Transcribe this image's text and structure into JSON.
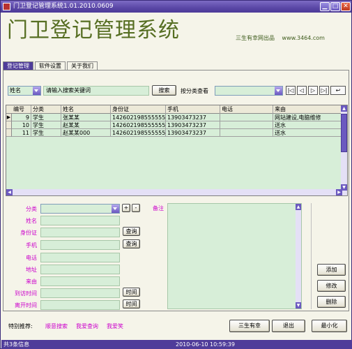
{
  "window": {
    "title": "门卫登记管理系统1.01.2010.0609"
  },
  "banner": {
    "title": "门卫登记管理系统",
    "credit": "三生有幸网出品",
    "url": "www.3464.com"
  },
  "tabs": [
    "登记管理",
    "软件设置",
    "关于我们"
  ],
  "search": {
    "field": "姓名",
    "placeholder_value": "请输入搜索关键词",
    "search_button": "搜索",
    "category_label": "按分类查看",
    "category_value": "",
    "nav": [
      "|◁",
      "◁",
      "▷",
      "▷|",
      "↩"
    ]
  },
  "grid": {
    "columns": [
      "编号",
      "分类",
      "姓名",
      "身份证",
      "手机",
      "电话",
      "来由"
    ],
    "rows": [
      {
        "id": "9",
        "category": "学生",
        "name": "张某某",
        "idcard": "142602198555555",
        "mobile": "13903473237",
        "phone": "",
        "reason": "网站建设,电脑维修"
      },
      {
        "id": "10",
        "category": "学生",
        "name": "赵某某",
        "idcard": "142602198555555",
        "mobile": "13903473237",
        "phone": "",
        "reason": "送水"
      },
      {
        "id": "11",
        "category": "学生",
        "name": "赵某某000",
        "idcard": "142602198555555",
        "mobile": "13903473237",
        "phone": "",
        "reason": "送水"
      }
    ],
    "selected_row": 0
  },
  "form": {
    "labels": [
      "分类",
      "姓名",
      "身份证",
      "手机",
      "电话",
      "地址",
      "来由",
      "到访时间",
      "离开时间"
    ],
    "lookup_button": "查询",
    "time_button": "时间",
    "add_symbol": "+",
    "remove_symbol": "-",
    "memo_label": "备注"
  },
  "actions": {
    "add": "添加",
    "edit": "修改",
    "delete": "删除"
  },
  "footer": {
    "special_label": "特别推荐:",
    "links": [
      "顺意搜索",
      "我爱查询",
      "我爱笑"
    ],
    "buttons": [
      "三生有幸",
      "退出",
      "最小化"
    ]
  },
  "status": {
    "count": "共3条信息",
    "datetime": "2010-06-10 10:59:39"
  },
  "colors": {
    "accent": "#4f3c9a",
    "field": "#d7eed8",
    "title_green": "#566e22",
    "label_magenta": "#cc00cc"
  }
}
